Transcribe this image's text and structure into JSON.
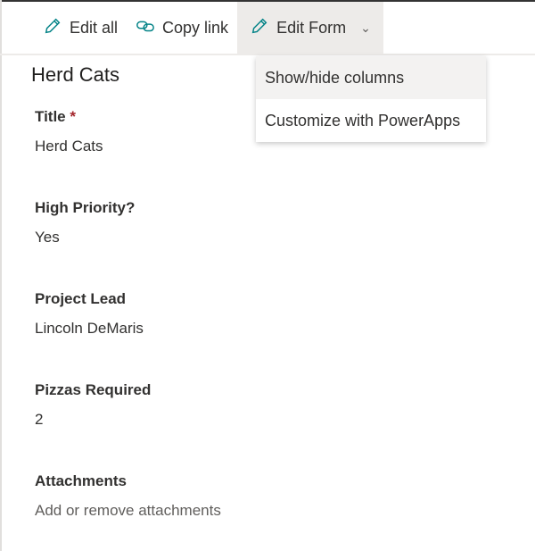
{
  "commands": {
    "edit_all": "Edit all",
    "copy_link": "Copy link",
    "edit_form": "Edit Form"
  },
  "menu": [
    "Show/hide columns",
    "Customize with PowerApps"
  ],
  "item_title": "Herd Cats",
  "fields": [
    {
      "label": "Title",
      "required": "*",
      "value": "Herd Cats"
    },
    {
      "label": "High Priority?",
      "value": "Yes"
    },
    {
      "label": "Project Lead",
      "value": "Lincoln DeMaris"
    },
    {
      "label": "Pizzas Required",
      "value": "2"
    },
    {
      "label": "Attachments",
      "value": "Add or remove attachments"
    }
  ],
  "colors": {
    "accent": "#038387"
  }
}
